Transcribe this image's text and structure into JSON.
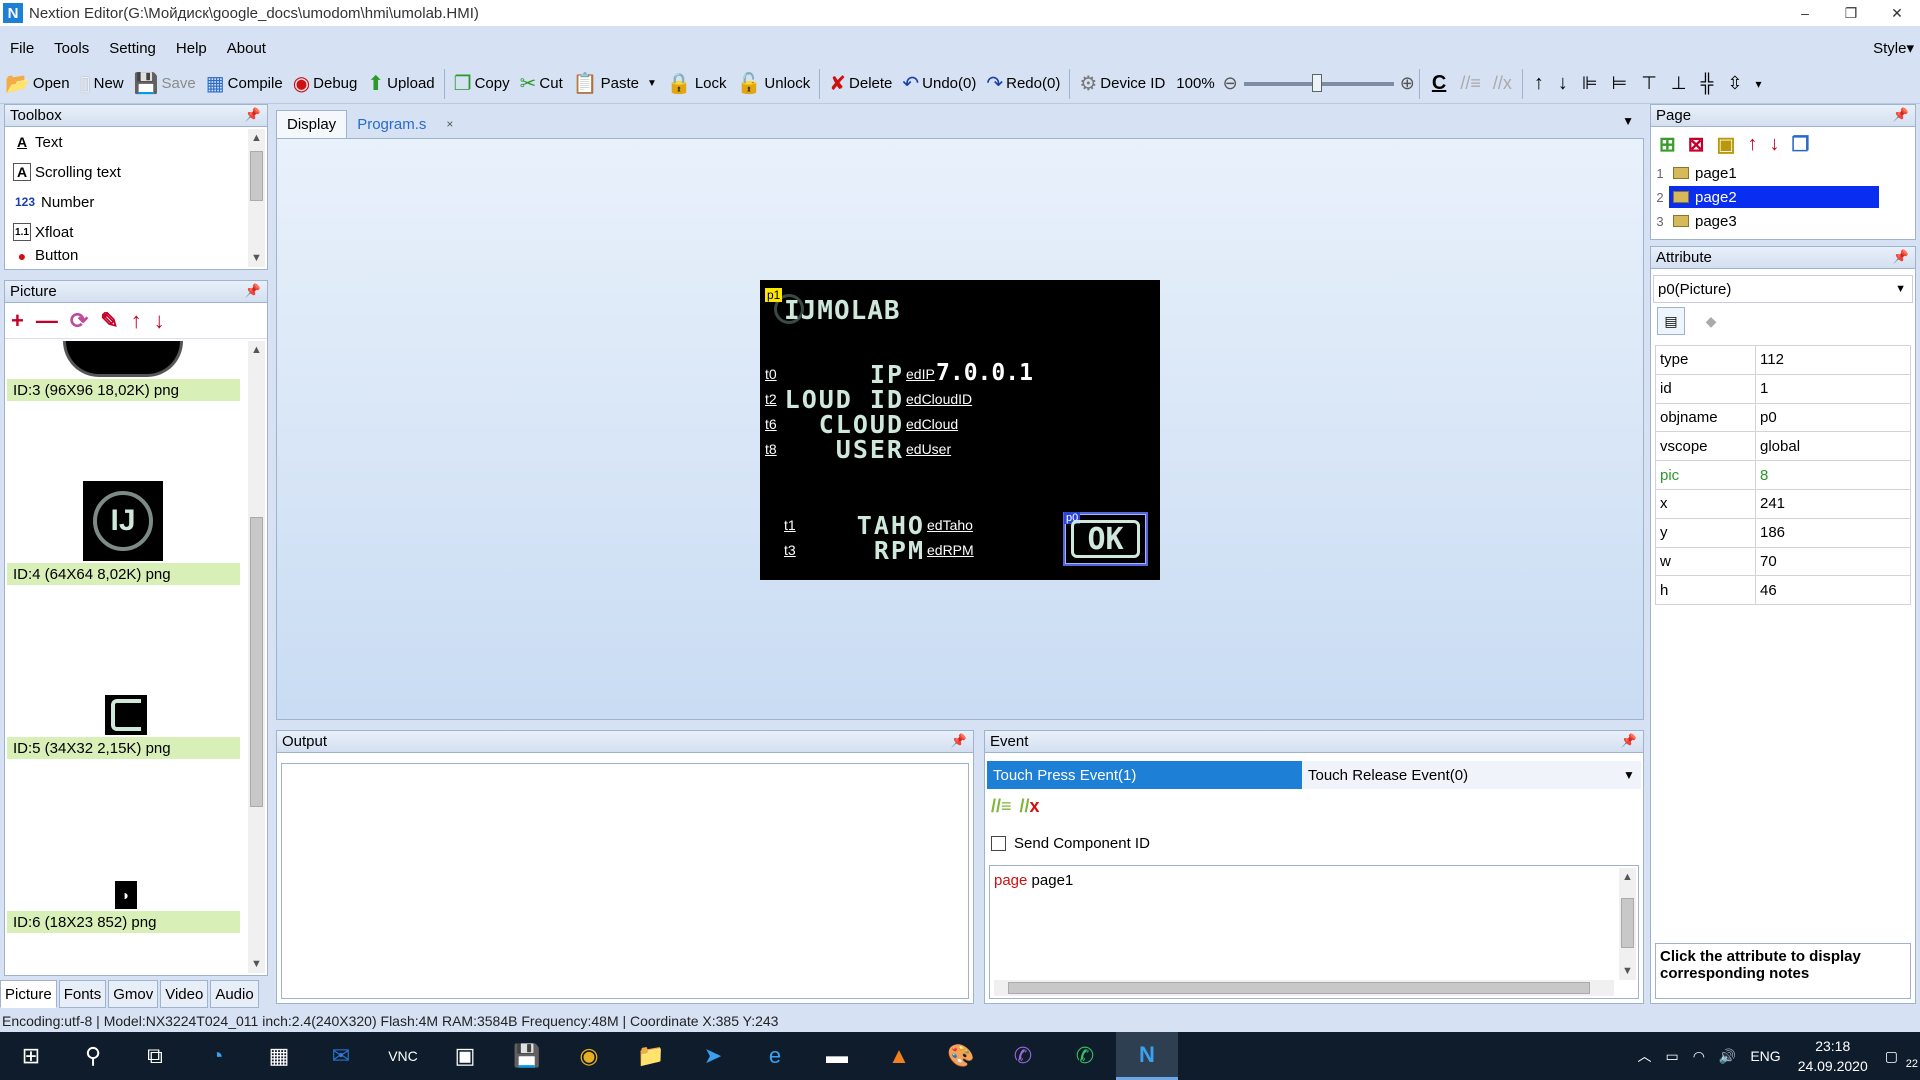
{
  "window": {
    "title": "Nextion Editor(G:\\Мойдиск\\google_docs\\umodom\\hmi\\umolab.HMI)",
    "app_icon": "nextion-logo",
    "controls": [
      "–",
      "❐",
      "✕"
    ]
  },
  "menu": {
    "items": [
      "File",
      "Tools",
      "Setting",
      "Help",
      "About"
    ],
    "style": "Style"
  },
  "toolbar": {
    "open": "Open",
    "new": "New",
    "save": "Save",
    "compile": "Compile",
    "debug": "Debug",
    "upload": "Upload",
    "copy": "Copy",
    "cut": "Cut",
    "paste": "Paste",
    "lock": "Lock",
    "unlock": "Unlock",
    "delete": "Delete",
    "undo": "Undo(0)",
    "redo": "Redo(0)",
    "device_id": "Device  ID",
    "zoom": "100%"
  },
  "toolbox": {
    "title": "Toolbox",
    "items": [
      {
        "icon": "A",
        "label": "Text"
      },
      {
        "icon": "A",
        "label": "Scrolling text"
      },
      {
        "icon": "123",
        "label": "Number"
      },
      {
        "icon": "1.1",
        "label": "Xfloat"
      },
      {
        "icon": "●",
        "label": "Button"
      }
    ]
  },
  "picture": {
    "title": "Picture",
    "items": [
      {
        "label": "ID:3  (96X96 18,02K) png"
      },
      {
        "label": "ID:4  (64X64 8,02K) png"
      },
      {
        "label": "ID:5  (34X32 2,15K) png"
      },
      {
        "label": "ID:6  (18X23 852) png"
      }
    ],
    "bottom_tabs": [
      "Picture",
      "Fonts",
      "Gmov",
      "Video",
      "Audio"
    ]
  },
  "editor": {
    "tabs": [
      "Display",
      "Program.s"
    ],
    "close_glyph": "×"
  },
  "hmi": {
    "page_tag": "p1",
    "logo_text": "IJMOLAB",
    "rows": [
      {
        "t": "t0",
        "big": "IP",
        "ed": "edIP"
      },
      {
        "t": "t2",
        "big": "LOUD  ID",
        "ed": "edCloudID"
      },
      {
        "t": "t6",
        "big": "CLOUD",
        "ed": "edCloud"
      },
      {
        "t": "t8",
        "big": "USER",
        "ed": "edUser"
      },
      {
        "t": "t1",
        "big": "TAHO",
        "ed": "edTaho"
      },
      {
        "t": "t3",
        "big": "RPM",
        "ed": "edRPM"
      }
    ],
    "ip_value": "7.0.0.1",
    "ok_tag": "p0",
    "ok_text": "OK"
  },
  "output": {
    "title": "Output"
  },
  "event": {
    "title": "Event",
    "tab_press": "Touch Press Event(1)",
    "tab_release": "Touch Release Event(0)",
    "send_component_id": "Send Component ID",
    "code_keyword": "page",
    "code_arg": " page1"
  },
  "page_panel": {
    "title": "Page",
    "pages": [
      {
        "num": "1",
        "name": "page1"
      },
      {
        "num": "2",
        "name": "page2"
      },
      {
        "num": "3",
        "name": "page3"
      }
    ],
    "selected": "page2"
  },
  "attribute": {
    "title": "Attribute",
    "object": "p0(Picture)",
    "rows": [
      {
        "key": "type",
        "value": "112"
      },
      {
        "key": "id",
        "value": "1"
      },
      {
        "key": "objname",
        "value": "p0"
      },
      {
        "key": "vscope",
        "value": "global"
      },
      {
        "key": "pic",
        "value": "8"
      },
      {
        "key": "x",
        "value": "241"
      },
      {
        "key": "y",
        "value": "186"
      },
      {
        "key": "w",
        "value": "70"
      },
      {
        "key": "h",
        "value": "46"
      }
    ],
    "note": "Click the attribute to display corresponding notes"
  },
  "status": {
    "text": "Encoding:utf-8 | Model:NX3224T024_011 inch:2.4(240X320) Flash:4M RAM:3584B Frequency:48M |    Coordinate X:385  Y:243"
  },
  "taskbar": {
    "lang": "ENG",
    "time": "23:18",
    "date": "24.09.2020",
    "notifications": "22"
  },
  "colors": {
    "accent": "#1e7fd6",
    "selected_page": "#0a2ef0",
    "keyword": "#d01010",
    "pic_label_bg": "#d9efb8"
  }
}
